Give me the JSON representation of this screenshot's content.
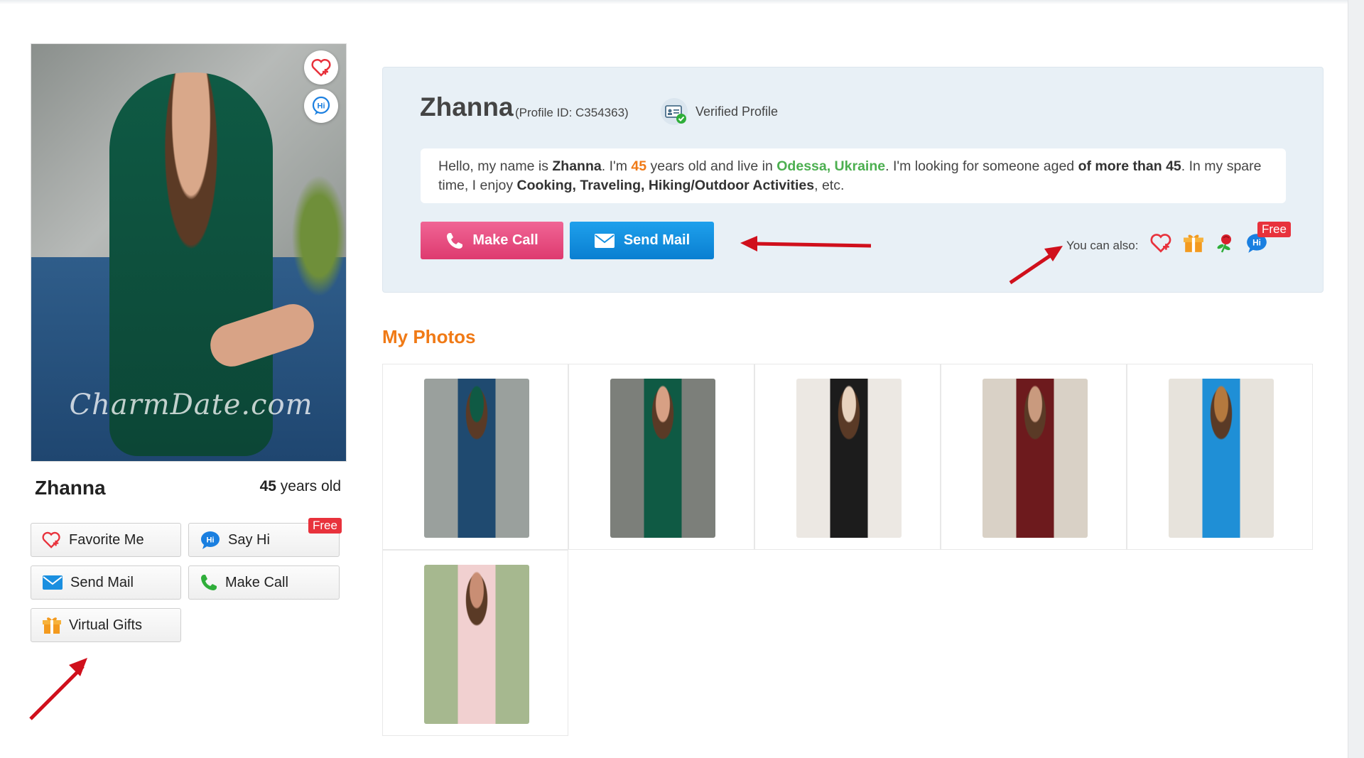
{
  "profile": {
    "name": "Zhanna",
    "age_number": "45",
    "age_suffix": " years old",
    "watermark": "CharmDate.com"
  },
  "sidebar_buttons": {
    "favorite": "Favorite Me",
    "say_hi": "Say Hi",
    "free_tag": "Free",
    "send_mail": "Send Mail",
    "make_call": "Make Call",
    "virtual_gifts": "Virtual Gifts"
  },
  "photo_badges": {
    "hi_label": "Hi"
  },
  "info": {
    "name": "Zhanna",
    "profile_id": "(Profile ID: C354363)",
    "verified_label": "Verified Profile",
    "intro": {
      "p1": "Hello, my name is ",
      "name": "Zhanna",
      "p2": ". I'm ",
      "age": "45",
      "p3": " years old and live in ",
      "location": "Odessa, Ukraine",
      "p4": ". I'm looking for someone aged ",
      "seek": "of more than 45",
      "p5": ". In my spare time, I enjoy ",
      "hobbies": "Cooking, Traveling, Hiking/Outdoor Activities",
      "p6": ", etc."
    },
    "make_call": "Make Call",
    "send_mail": "Send Mail",
    "you_can_also": "You can also:",
    "free_tag": "Free"
  },
  "photos": {
    "title": "My Photos",
    "items": [
      {
        "alt": "photo-1",
        "palette": [
          "#9aa09d",
          "#1f4a70",
          "#0f5a44"
        ]
      },
      {
        "alt": "photo-2",
        "palette": [
          "#7c7f7a",
          "#0f5a44",
          "#d7a084"
        ]
      },
      {
        "alt": "photo-3",
        "palette": [
          "#ece8e3",
          "#1c1c1c",
          "#e8d3bf"
        ]
      },
      {
        "alt": "photo-4",
        "palette": [
          "#d9d1c6",
          "#6d1a1d",
          "#c99a7e"
        ]
      },
      {
        "alt": "photo-5",
        "palette": [
          "#e7e3dc",
          "#1f8fd6",
          "#b5793e"
        ]
      },
      {
        "alt": "photo-6",
        "palette": [
          "#a6b88f",
          "#f1d0d0",
          "#c98e74"
        ]
      }
    ]
  },
  "colors": {
    "accent_orange": "#f07a16",
    "call_pink": "#e8457d",
    "mail_blue": "#1590e0",
    "free_red": "#e8323c",
    "panel_bg": "#e8f0f6",
    "annotation_arrow": "#d0101c"
  }
}
